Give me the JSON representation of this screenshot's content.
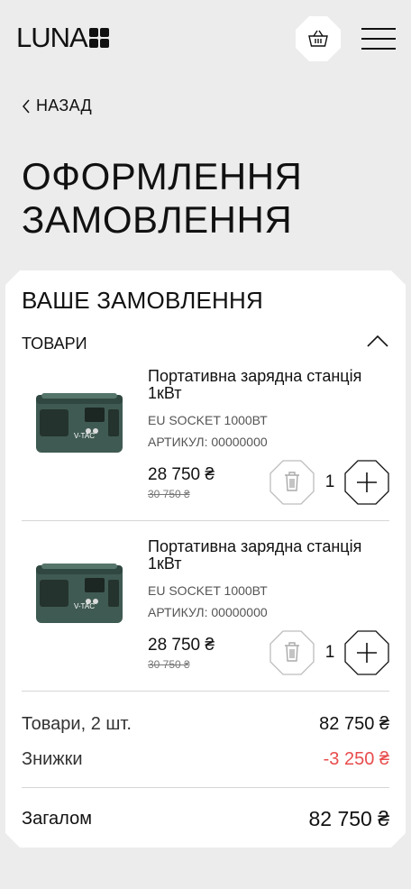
{
  "header": {
    "logo_text": "LUNA",
    "icons": {
      "cart": "shopping-basket-icon",
      "menu": "hamburger-menu-icon"
    }
  },
  "nav": {
    "back_label": "НАЗАД"
  },
  "page": {
    "title": "ОФОРМЛЕННЯ ЗАМОВЛЕННЯ"
  },
  "order": {
    "title": "ВАШЕ ЗАМОВЛЕННЯ",
    "section_label": "ТОВАРИ",
    "items": [
      {
        "name": "Портативна зарядна станція 1кВт",
        "variant": "EU SOCKET 1000ВТ",
        "sku": "АРТИКУЛ: 00000000",
        "price": "28 750 ₴",
        "old_price": "30 750 ₴",
        "quantity": "1",
        "image_label": "V-TAC"
      },
      {
        "name": "Портативна зарядна станція 1кВт",
        "variant": "EU SOCKET 1000ВТ",
        "sku": "АРТИКУЛ: 00000000",
        "price": "28 750 ₴",
        "old_price": "30 750 ₴",
        "quantity": "1",
        "image_label": "V-TAC"
      }
    ],
    "summary": {
      "items_label": "Товари, 2 шт.",
      "items_value": "82 750 ₴",
      "discount_label": "Знижки",
      "discount_value": "-3 250 ₴",
      "total_label": "Загалом",
      "total_value": "82 750 ₴"
    }
  },
  "colors": {
    "background": "#ececec",
    "card": "#ffffff",
    "text": "#111111",
    "discount": "#e84c4c",
    "product": "#3f5a52"
  }
}
